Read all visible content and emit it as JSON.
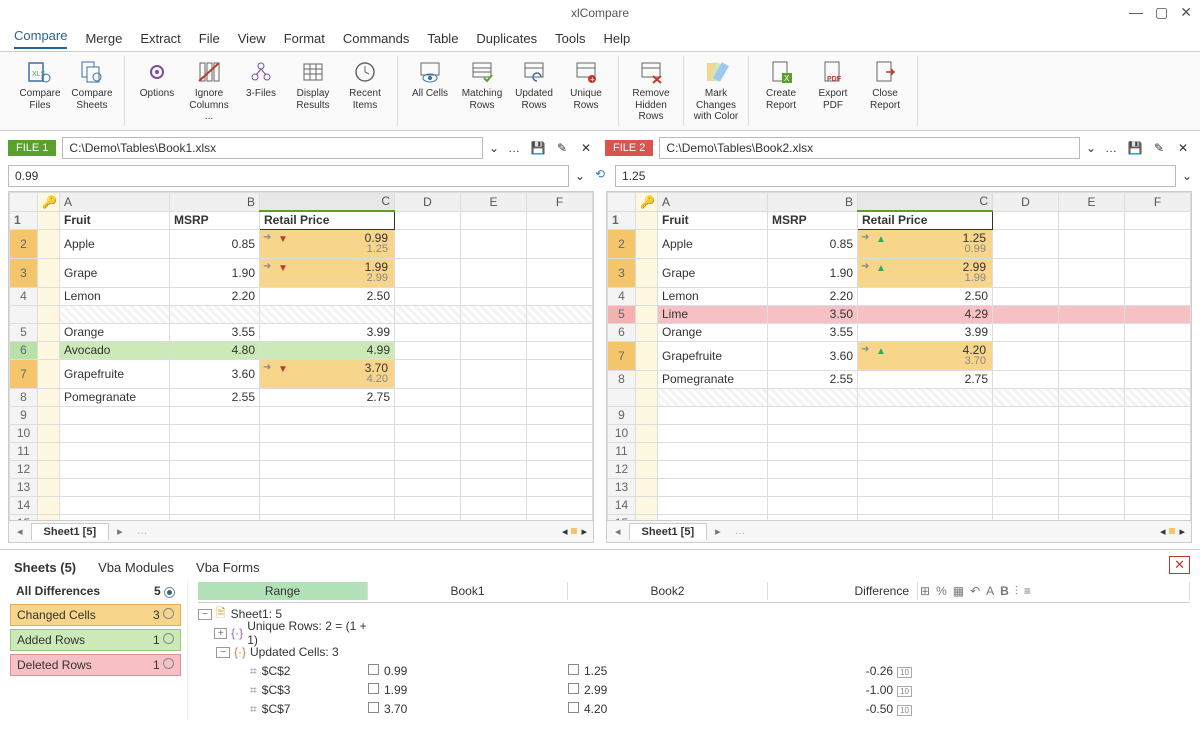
{
  "title": "xlCompare",
  "menu": [
    "Compare",
    "Merge",
    "Extract",
    "File",
    "View",
    "Format",
    "Commands",
    "Table",
    "Duplicates",
    "Tools",
    "Help"
  ],
  "ribbon": [
    {
      "label": "Compare\nFiles",
      "icon": "xls-compare"
    },
    {
      "label": "Compare\nSheets",
      "icon": "xls-sheets"
    },
    {
      "label": "Options",
      "icon": "gear"
    },
    {
      "label": "Ignore\nColumns ...",
      "icon": "columns-strike"
    },
    {
      "label": "3-Files",
      "icon": "three-files"
    },
    {
      "label": "Display\nResults",
      "icon": "table"
    },
    {
      "label": "Recent\nItems",
      "icon": "clock"
    },
    {
      "label": "All Cells",
      "icon": "eye-grid"
    },
    {
      "label": "Matching\nRows",
      "icon": "rows-check"
    },
    {
      "label": "Updated\nRows",
      "icon": "rows-update"
    },
    {
      "label": "Unique\nRows",
      "icon": "rows-plus"
    },
    {
      "label": "Remove\nHidden Rows",
      "icon": "rows-x"
    },
    {
      "label": "Mark Changes\nwith Color",
      "icon": "swatches"
    },
    {
      "label": "Create\nReport",
      "icon": "report"
    },
    {
      "label": "Export\nPDF",
      "icon": "pdf"
    },
    {
      "label": "Close\nReport",
      "icon": "close-report"
    }
  ],
  "left": {
    "tag": "FILE 1",
    "path": "C:\\Demo\\Tables\\Book1.xlsx",
    "formula": "0.99",
    "columns": [
      "A",
      "B",
      "C",
      "D",
      "E",
      "F"
    ],
    "headerRow": {
      "A": "Fruit",
      "B": "MSRP",
      "C": "Retail Price"
    },
    "rows": [
      {
        "n": 2,
        "A": "Apple",
        "B": "0.85",
        "C": {
          "main": "0.99",
          "sub": "1.25",
          "dir": "down"
        },
        "rcls": "rownum-orange"
      },
      {
        "n": 3,
        "A": "Grape",
        "B": "1.90",
        "C": {
          "main": "1.99",
          "sub": "2.99",
          "dir": "down"
        },
        "rcls": "rownum-orange"
      },
      {
        "n": 4,
        "A": "Lemon",
        "B": "2.20",
        "C": "2.50"
      },
      {
        "n": 5,
        "A": "Orange",
        "B": "3.55",
        "C": "3.99"
      },
      {
        "n": 6,
        "A": "Avocado",
        "B": "4.80",
        "C": "4.99",
        "rcls": "rownum-green",
        "added": true
      },
      {
        "n": 7,
        "A": "Grapefruite",
        "B": "3.60",
        "C": {
          "main": "3.70",
          "sub": "4.20",
          "dir": "down"
        },
        "rcls": "rownum-orange"
      },
      {
        "n": 8,
        "A": "Pomegranate",
        "B": "2.55",
        "C": "2.75"
      }
    ],
    "sheet_tab": "Sheet1 [5]"
  },
  "right": {
    "tag": "FILE 2",
    "path": "C:\\Demo\\Tables\\Book2.xlsx",
    "formula": "1.25",
    "columns": [
      "A",
      "B",
      "C",
      "D",
      "E",
      "F"
    ],
    "headerRow": {
      "A": "Fruit",
      "B": "MSRP",
      "C": "Retail Price"
    },
    "rows": [
      {
        "n": 2,
        "A": "Apple",
        "B": "0.85",
        "C": {
          "main": "1.25",
          "sub": "0.99",
          "dir": "up"
        },
        "rcls": "rownum-orange"
      },
      {
        "n": 3,
        "A": "Grape",
        "B": "1.90",
        "C": {
          "main": "2.99",
          "sub": "1.99",
          "dir": "up"
        },
        "rcls": "rownum-orange"
      },
      {
        "n": 4,
        "A": "Lemon",
        "B": "2.20",
        "C": "2.50"
      },
      {
        "n": 5,
        "A": "Lime",
        "B": "3.50",
        "C": "4.29",
        "rcls": "rownum-pink",
        "deleted": true
      },
      {
        "n": 6,
        "A": "Orange",
        "B": "3.55",
        "C": "3.99"
      },
      {
        "n": 7,
        "A": "Grapefruite",
        "B": "3.60",
        "C": {
          "main": "4.20",
          "sub": "3.70",
          "dir": "up"
        },
        "rcls": "rownum-orange"
      },
      {
        "n": 8,
        "A": "Pomegranate",
        "B": "2.55",
        "C": "2.75"
      }
    ],
    "sheet_tab": "Sheet1 [5]"
  },
  "bottom_tabs": [
    "Sheets (5)",
    "Vba Modules",
    "Vba Forms"
  ],
  "filters": {
    "all": {
      "label": "All Differences",
      "count": "5"
    },
    "changed": {
      "label": "Changed Cells",
      "count": "3"
    },
    "added": {
      "label": "Added Rows",
      "count": "1"
    },
    "deleted": {
      "label": "Deleted Rows",
      "count": "1"
    }
  },
  "diff_header": {
    "range": "Range",
    "b1": "Book1",
    "b2": "Book2",
    "diff": "Difference"
  },
  "tree": {
    "sheet": "Sheet1: 5",
    "unique": "Unique Rows: 2 = (1 + 1)",
    "updated": "Updated Cells: 3",
    "cells": [
      {
        "range": "$C$2",
        "b1": "0.99",
        "b2": "1.25",
        "diff": "-0.26"
      },
      {
        "range": "$C$3",
        "b1": "1.99",
        "b2": "2.99",
        "diff": "-1.00"
      },
      {
        "range": "$C$7",
        "b1": "3.70",
        "b2": "4.20",
        "diff": "-0.50"
      }
    ]
  }
}
